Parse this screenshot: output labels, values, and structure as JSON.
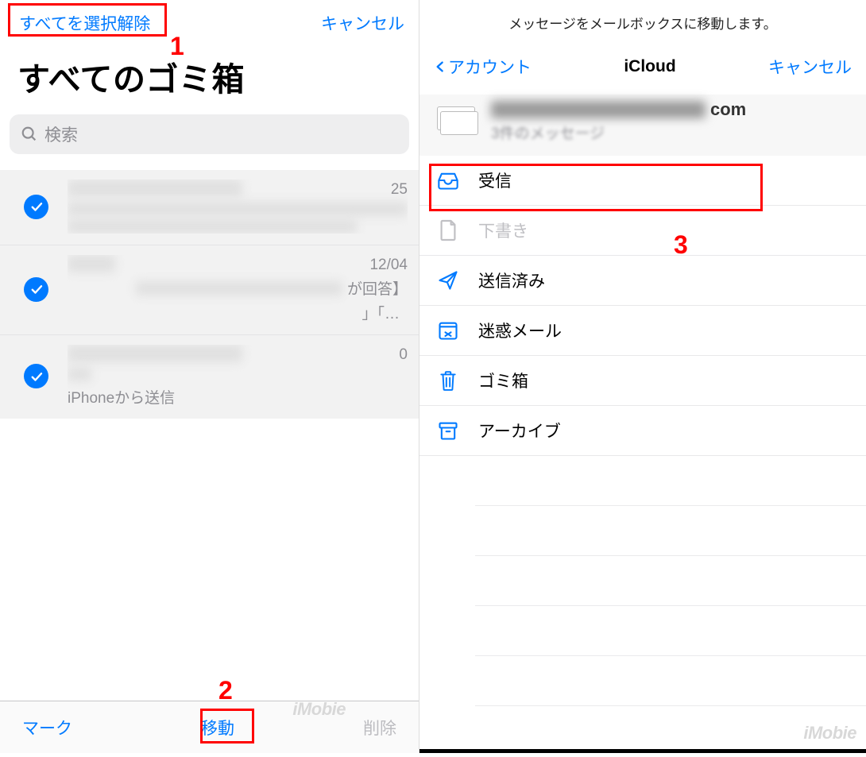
{
  "left": {
    "nav": {
      "deselect": "すべてを選択解除",
      "cancel": "キャンセル"
    },
    "title": "すべてのゴミ箱",
    "search_placeholder": "検索",
    "items": [
      {
        "date": "25",
        "preview": ""
      },
      {
        "date": "12/04",
        "preview_suffix": "が回答】",
        "preview_line2": "」「…"
      },
      {
        "date": "0",
        "preview": "iPhoneから送信"
      }
    ],
    "toolbar": {
      "mark": "マーク",
      "move": "移動",
      "delete": "削除"
    }
  },
  "right": {
    "hint": "メッセージをメールボックスに移動します。",
    "back": "アカウント",
    "title": "iCloud",
    "cancel": "キャンセル",
    "account": {
      "email_suffix": "com",
      "count": "3件のメッセージ"
    },
    "folders": {
      "inbox": "受信",
      "drafts": "下書き",
      "sent": "送信済み",
      "junk": "迷惑メール",
      "trash": "ゴミ箱",
      "archive": "アーカイブ"
    }
  },
  "annotations": {
    "n1": "1",
    "n2": "2",
    "n3": "3"
  },
  "watermark": "iMobie"
}
